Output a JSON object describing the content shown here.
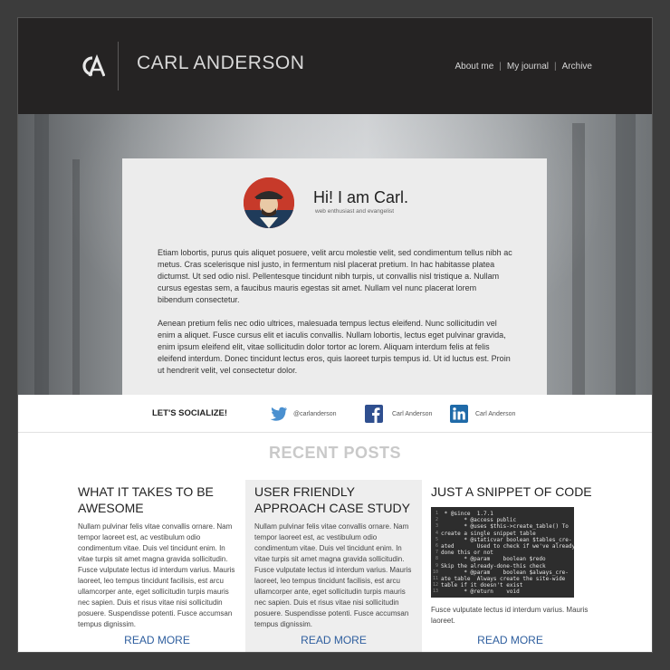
{
  "header": {
    "site_title": "CARL ANDERSON",
    "logo_icon": "ca-monogram-icon",
    "nav": [
      "About me",
      "My journal",
      "Archive"
    ]
  },
  "hero": {
    "greeting": "Hi! I am Carl.",
    "tagline": "web enthusiast and evangelist",
    "paragraph1": "Etiam lobortis, purus quis aliquet posuere, velit arcu molestie velit, sed condimentum tellus nibh ac metus. Cras scelerisque nisl justo, in fermentum nisl placerat pretium. In hac habitasse platea dictumst. Ut sed odio nisl. Pellentesque tincidunt nibh turpis, ut convallis nisl tristique a. Nullam cursus egestas sem, a faucibus mauris egestas sit amet. Nullam vel nunc placerat lorem bibendum consectetur.",
    "paragraph2": "Aenean pretium felis nec odio ultrices, malesuada tempus lectus eleifend. Nunc sollicitudin vel enim a aliquet. Fusce cursus elit et iaculis convallis. Nullam lobortis, lectus eget pulvinar gravida, enim ipsum eleifend elit, vitae sollicitudin dolor tortor ac lorem. Aliquam interdum felis at felis eleifend interdum. Donec tincidunt lectus eros, quis laoreet turpis tempus id. Ut id luctus est. Proin ut hendrerit velit, vel consectetur dolor."
  },
  "social": {
    "title": "LET'S SOCIALIZE!",
    "items": [
      {
        "icon": "twitter-icon",
        "label": "@carlanderson"
      },
      {
        "icon": "facebook-icon",
        "label": "Carl Anderson"
      },
      {
        "icon": "linkedin-icon",
        "label": "Carl Anderson"
      }
    ]
  },
  "recent": {
    "title": "RECENT POSTS",
    "posts": [
      {
        "title": "WHAT IT TAKES TO BE AWESOME",
        "body": "Nullam pulvinar felis vitae convallis ornare. Nam tempor laoreet est, ac vestibulum odio condimentum vitae. Duis vel tincidunt enim. In vitae turpis sit amet magna gravida sollicitudin. Fusce vulputate lectus id interdum varius. Mauris laoreet, leo tempus tincidunt facilisis, est arcu ullamcorper ante, eget sollicitudin turpis mauris nec sapien. Duis et risus vitae nisi sollicitudin posuere. Suspendisse potenti. Fusce accumsan tempus dignissim.",
        "read_more": "READ MORE"
      },
      {
        "title": "USER FRIENDLY APPROACH CASE STUDY",
        "body": "Nullam pulvinar felis vitae convallis ornare. Nam tempor laoreet est, ac vestibulum odio condimentum vitae. Duis vel tincidunt enim. In vitae turpis sit amet magna gravida sollicitudin. Fusce vulputate lectus id interdum varius. Mauris laoreet, leo tempus tincidunt facilisis, est arcu ullamcorper ante, eget sollicitudin turpis mauris nec sapien. Duis et risus vitae nisi sollicitudin posuere. Suspendisse potenti. Fusce accumsan tempus dignissim.",
        "read_more": "READ MORE"
      },
      {
        "title": "JUST A SNIPPET OF CODE",
        "code_line_numbers": [
          "1",
          "2",
          "3",
          "4",
          "5",
          "6",
          "7",
          "8",
          "9",
          "10",
          "11",
          "12",
          "13"
        ],
        "code": " * @since  1.7.1\n       * @access public\n       * @uses $this->create_table() To\ncreate a single snippet table\n       * @staticvar boolean $tables_cre-\nated       Used to check if we've already\ndone this or not\n       * @param    boolean $redo\nSkip the already-done-this check\n       * @param    boolean $always_cre-\nate_table  Always create the site-wide\ntable if it doesn't exist\n       * @return    void",
        "body": "Fusce vulputate lectus id interdum varius. Mauris laoreet.",
        "read_more": "READ MORE"
      }
    ]
  }
}
